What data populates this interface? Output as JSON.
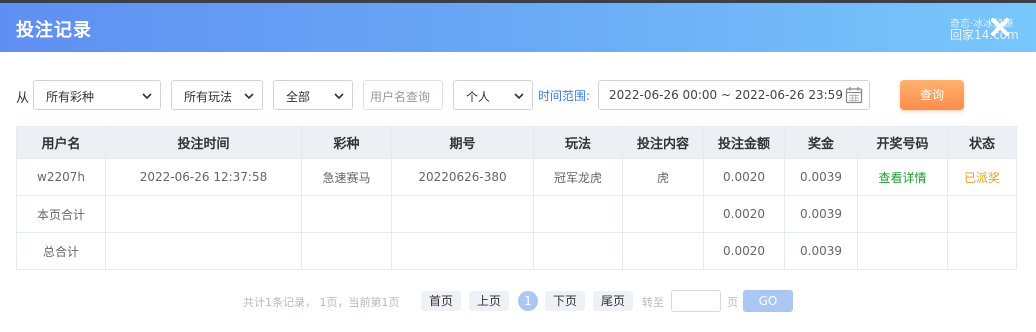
{
  "window": {
    "title": "投注记录",
    "watermark_line1": "奇恋·冰冰鼠源",
    "watermark_line2": "回家14.com",
    "close_icon": "close-icon"
  },
  "filters": {
    "from_label": "从",
    "lottery_select": "所有彩种",
    "play_select": "所有玩法",
    "status_select": "全部",
    "username_placeholder": "用户名查询",
    "scope_select": "个人",
    "range_label": "时间范围:",
    "date_range": "2022-06-26 00:00 ~ 2022-06-26 23:59",
    "query_button": "查询"
  },
  "table": {
    "headers": [
      "用户名",
      "投注时间",
      "彩种",
      "期号",
      "玩法",
      "投注内容",
      "投注金额",
      "奖金",
      "开奖号码",
      "状态"
    ],
    "rows": [
      [
        "w2207h",
        "2022-06-26 12:37:58",
        "急速赛马",
        "20220626-380",
        "冠军龙虎",
        "虎",
        "0.0020",
        "0.0039",
        "查看详情",
        "已派奖"
      ],
      [
        "本页合计",
        "",
        "",
        "",
        "",
        "",
        "0.0020",
        "0.0039",
        "",
        ""
      ],
      [
        "总合计",
        "",
        "",
        "",
        "",
        "",
        "0.0020",
        "0.0039",
        "",
        ""
      ]
    ]
  },
  "colors": {
    "accent_blue": "#3d7ee9",
    "link_green": "#1e9e2f",
    "status_orange": "#e9a11c",
    "query_orange": "#ff8d4e"
  },
  "pagination": {
    "info": "共计1条记录， 1页，当前第1页",
    "first": "首页",
    "prev": "上页",
    "current": "1",
    "next": "下页",
    "last": "尾页",
    "goto_label": "转至",
    "page_label": "页",
    "go_button": "GO"
  }
}
